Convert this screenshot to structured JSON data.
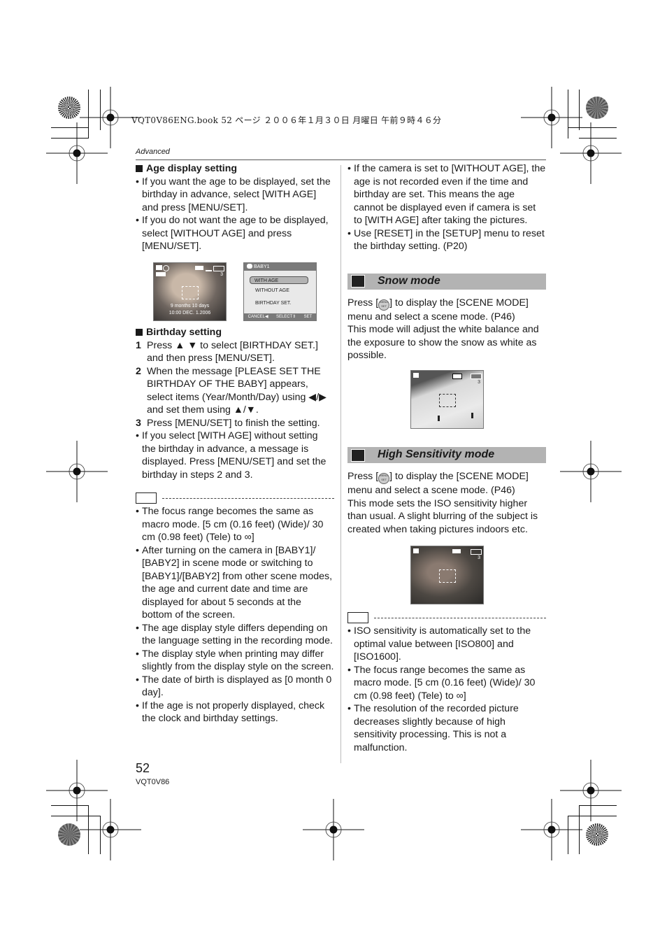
{
  "print_header": "VQT0V86ENG.book  52 ページ  ２００６年１月３０日  月曜日  午前９時４６分",
  "section_label": "Advanced",
  "left": {
    "age_display": {
      "heading": "Age display setting",
      "bullets": [
        "If you want the age to be displayed, set the birthday in advance, select [WITH AGE] and press [MENU/SET].",
        "If you do not want the age to be displayed, select [WITHOUT AGE] and press [MENU/SET]."
      ]
    },
    "screen_baby": {
      "count": "3",
      "age_text": "9 months 10 days",
      "datetime": "10:00  DEC. 1.2006"
    },
    "screen_menu": {
      "title": "BABY1",
      "options": [
        "WITH AGE",
        "WITHOUT AGE",
        "BIRTHDAY SET."
      ],
      "selected": "WITH AGE",
      "footer_cancel": "CANCEL◀",
      "footer_select": "SELECT⇕",
      "footer_set": "SET"
    },
    "birthday": {
      "heading": "Birthday setting",
      "steps": [
        {
          "n": "1",
          "text": "Press ▲ ▼ to select [BIRTHDAY SET.] and then press [MENU/SET]."
        },
        {
          "n": "2",
          "text": "When the message [PLEASE SET THE BIRTHDAY OF THE BABY] appears, select items (Year/Month/Day) using ◀/▶ and set them using ▲/▼."
        },
        {
          "n": "3",
          "text": "Press [MENU/SET] to finish the setting."
        }
      ],
      "bullets": [
        "If you select [WITH AGE] without setting the birthday in advance, a message is displayed. Press [MENU/SET] and set the birthday in steps 2 and 3."
      ]
    },
    "notes": [
      "The focus range becomes the same as macro mode. [5 cm (0.16 feet) (Wide)/ 30 cm (0.98 feet) (Tele) to ∞]",
      "After turning on the camera in [BABY1]/ [BABY2] in scene mode or switching to [BABY1]/[BABY2] from other scene modes, the age and current date and time are displayed for about 5 seconds at the bottom of the screen.",
      "The age display style differs depending on the language setting in the recording mode.",
      "The display style when printing may differ slightly from the display style on the screen.",
      "The date of birth is displayed as [0 month 0 day].",
      "If the age is not properly displayed, check the clock and birthday settings."
    ]
  },
  "right": {
    "bullets_top": [
      "If the camera is set to [WITHOUT AGE], the age is not recorded even if the time and birthday are set. This means the age cannot be displayed even if camera is set to [WITH AGE] after taking the pictures.",
      "Use [RESET] in the [SETUP] menu to reset the birthday setting. (P20)"
    ],
    "snow": {
      "title": "Snow mode",
      "icon": "snowman-icon",
      "press_before": "Press [",
      "press_after": "] to display the [SCENE MODE] menu and select a scene mode. (P46)",
      "body": "This mode will adjust the white balance and the exposure to show the snow as white as possible.",
      "screen_count": "3"
    },
    "high_sens": {
      "title": "High Sensitivity mode",
      "icon": "high-sensitivity-icon",
      "press_before": "Press [",
      "press_after": "] to display the [SCENE MODE] menu and select a scene mode. (P46)",
      "body": "This mode sets the ISO sensitivity higher than usual. A slight blurring of the subject is created when taking pictures indoors etc.",
      "screen_count": "3"
    },
    "notes": [
      "ISO sensitivity is automatically set to the optimal value between [ISO800] and [ISO1600].",
      "The focus range becomes the same as macro mode. [5 cm (0.16 feet) (Wide)/ 30 cm (0.98 feet) (Tele) to ∞]",
      "The resolution of the recorded picture decreases slightly because of high sensitivity processing. This is not a malfunction."
    ]
  },
  "menu_button_label": "MENU SET",
  "footer": {
    "page_number": "52",
    "model": "VQT0V86"
  }
}
